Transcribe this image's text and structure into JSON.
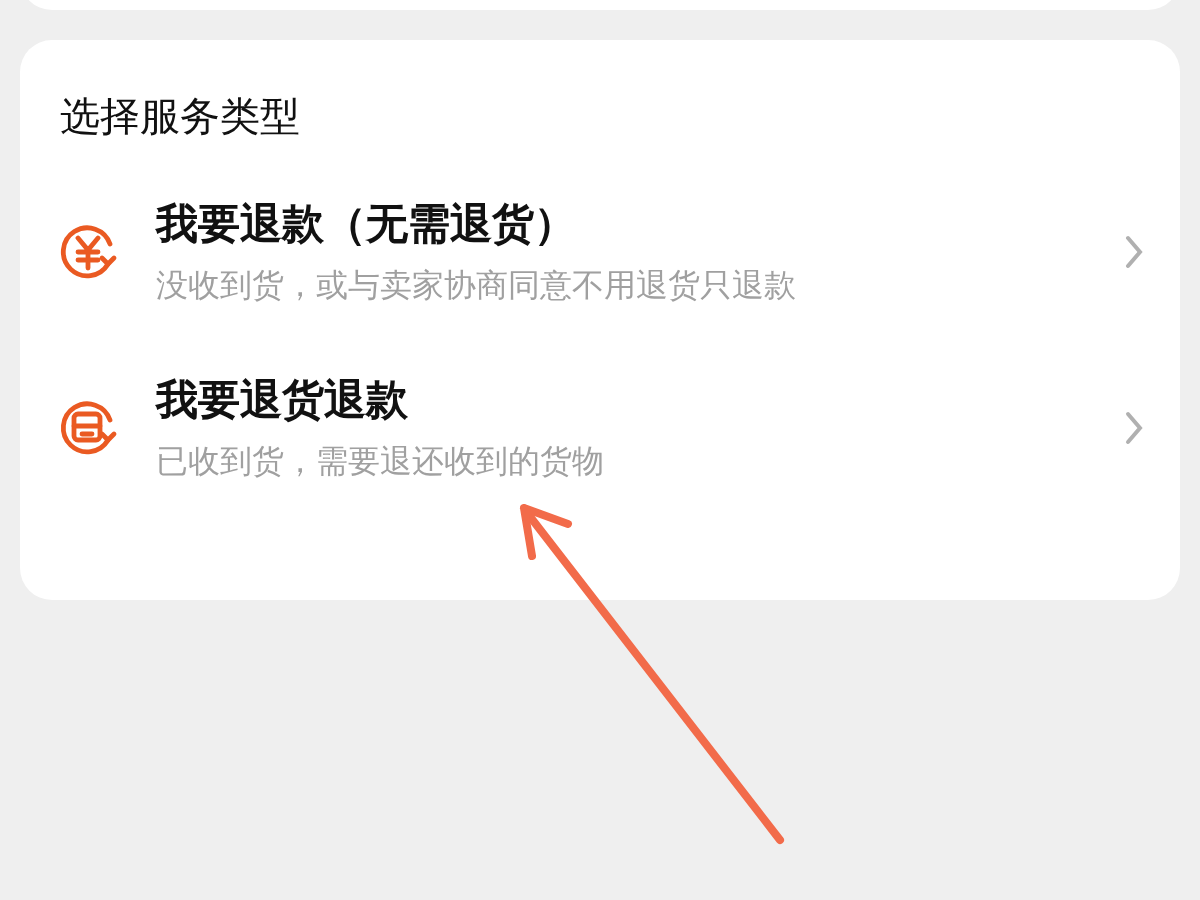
{
  "section_title": "选择服务类型",
  "options": [
    {
      "kind": "refund",
      "title": "我要退款（无需退货）",
      "subtitle": "没收到货，或与卖家协商同意不用退货只退款"
    },
    {
      "kind": "return",
      "title": "我要退货退款",
      "subtitle": "已收到货，需要退还收到的货物"
    }
  ]
}
